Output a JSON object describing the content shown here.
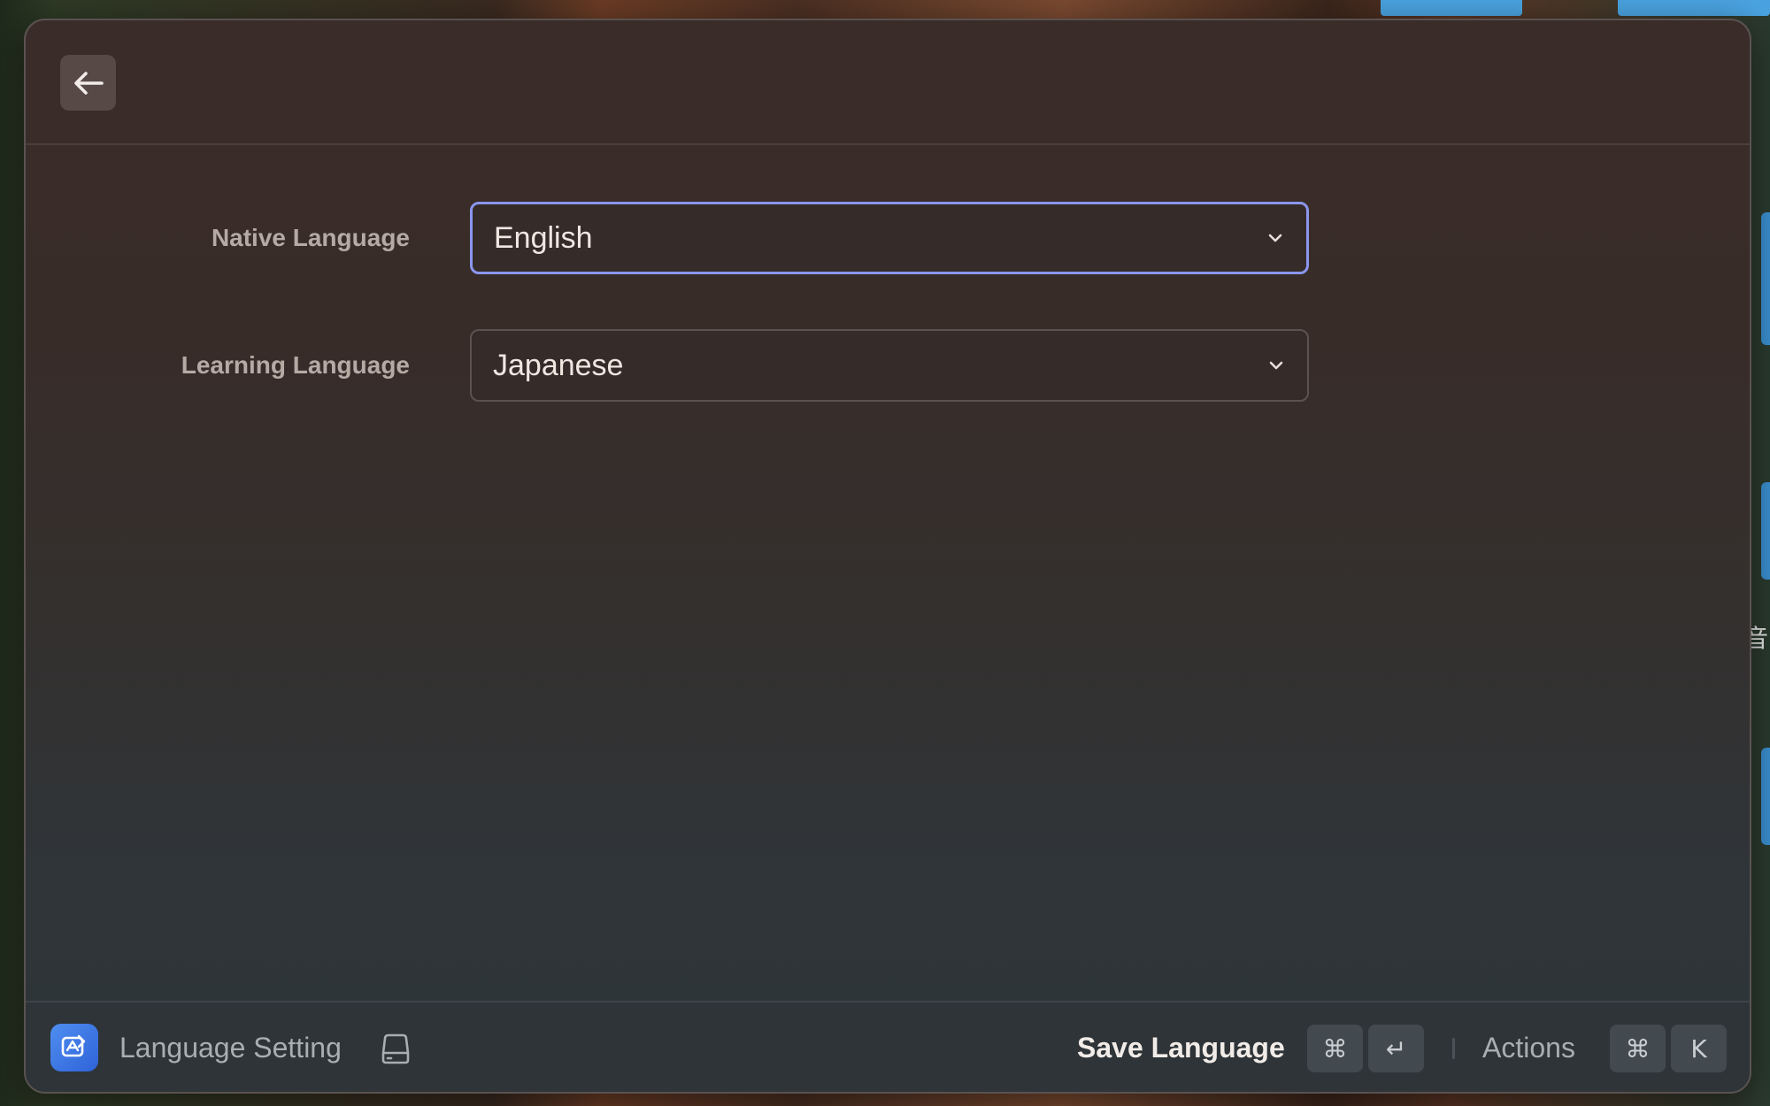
{
  "header": {
    "back_icon": "arrow-left-icon"
  },
  "form": {
    "native_language": {
      "label": "Native Language",
      "value": "English"
    },
    "learning_language": {
      "label": "Learning Language",
      "value": "Japanese"
    }
  },
  "footer": {
    "app_icon": "translate-app-icon",
    "title": "Language Setting",
    "title_icon": "drive-icon",
    "primary_action": "Save Language",
    "primary_shortcut": [
      "⌘",
      "↵"
    ],
    "actions_label": "Actions",
    "actions_shortcut": [
      "⌘",
      "K"
    ]
  },
  "desktop": {
    "edge_glyph": "音"
  },
  "colors": {
    "focus_ring": "#8a96ee",
    "app_icon_blue": "#3a74e6"
  }
}
